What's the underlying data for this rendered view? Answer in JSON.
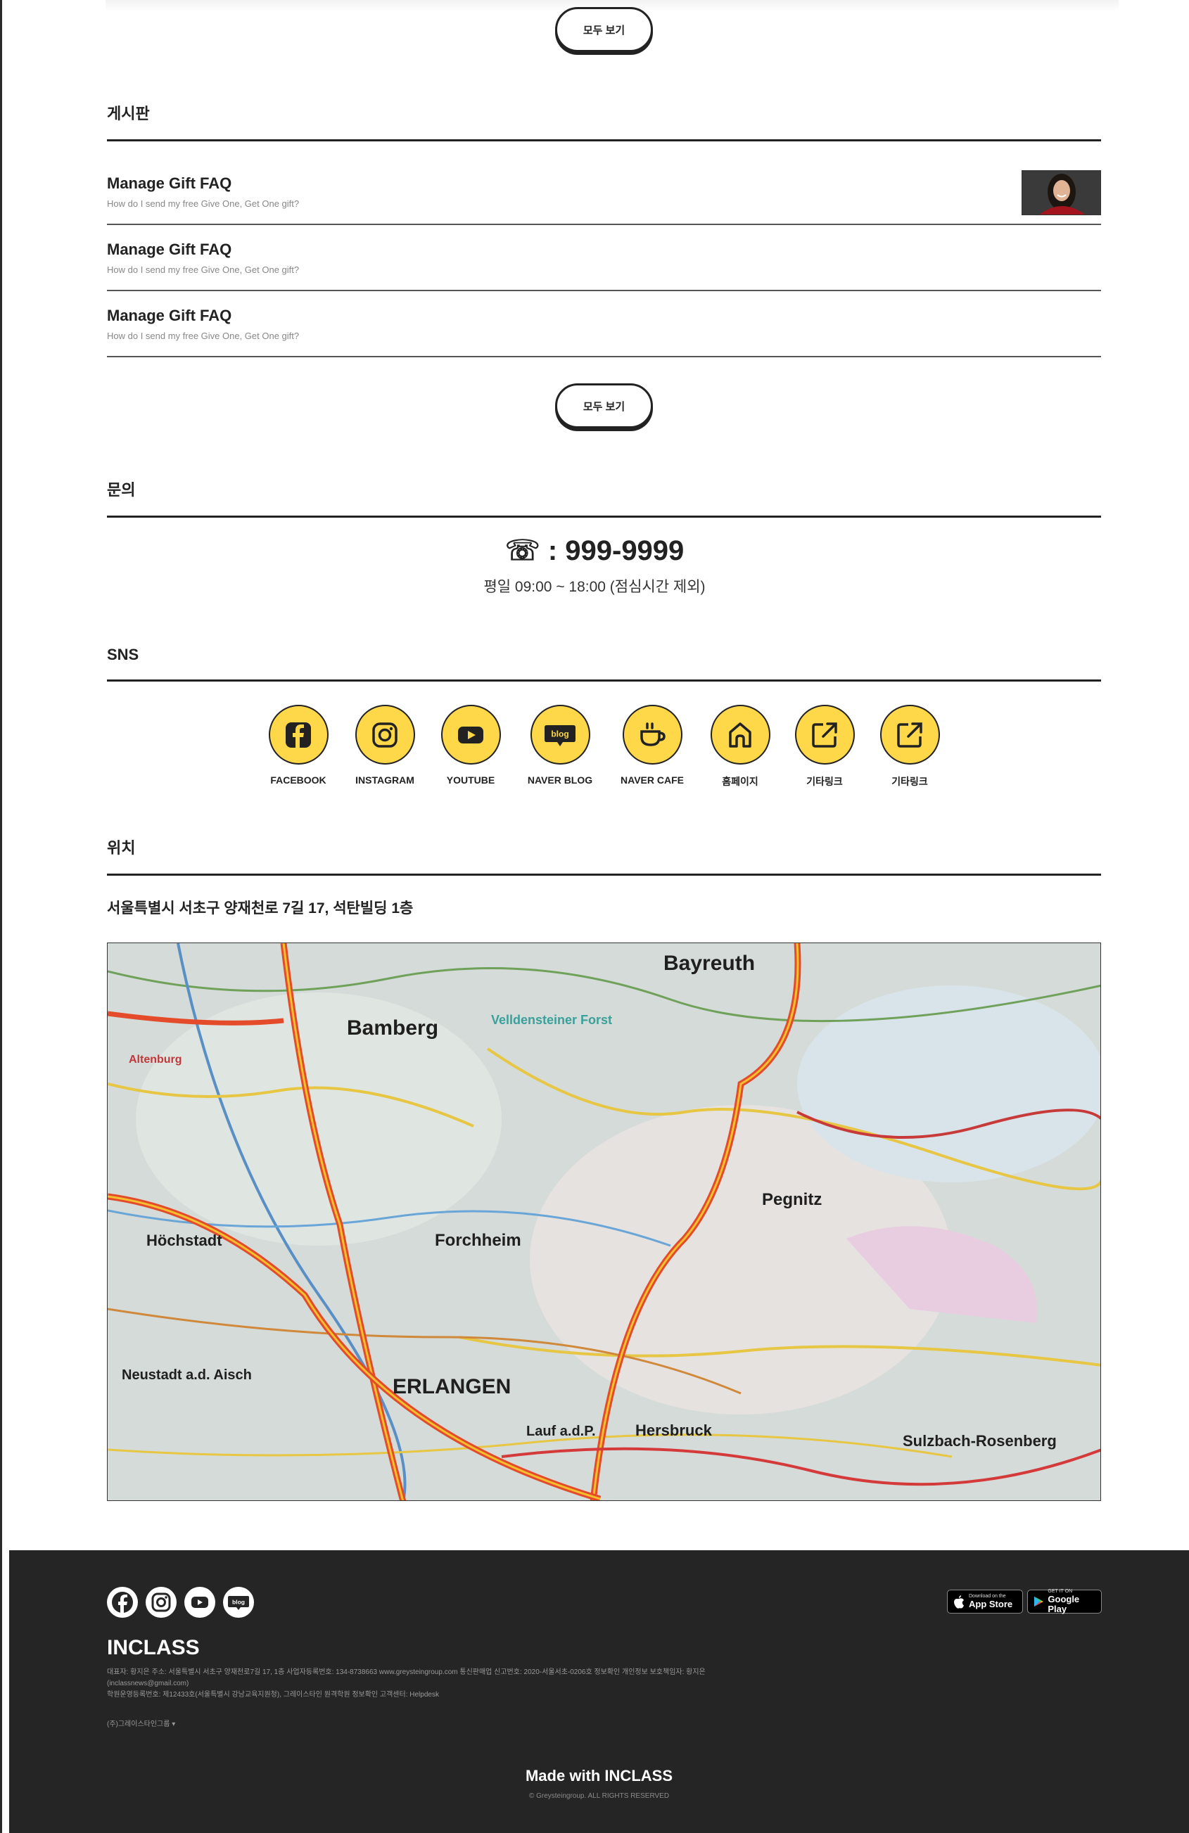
{
  "view_all_label": "모두 보기",
  "board": {
    "heading": "게시판",
    "posts": [
      {
        "title": "Manage Gift FAQ",
        "subtitle": "How do I send my free Give One, Get One gift?"
      },
      {
        "title": "Manage Gift FAQ",
        "subtitle": "How do I send my free Give One, Get One gift?"
      },
      {
        "title": "Manage Gift FAQ",
        "subtitle": "How do I send my free Give One, Get One gift?"
      }
    ]
  },
  "contact": {
    "heading": "문의",
    "phone": "☏ : 999-9999",
    "hours": "평일 09:00 ~ 18:00 (점심시간 제외)"
  },
  "sns": {
    "heading": "SNS",
    "accent_color": "#FFD84A",
    "items": [
      {
        "label": "FACEBOOK",
        "icon": "facebook-icon"
      },
      {
        "label": "INSTAGRAM",
        "icon": "instagram-icon"
      },
      {
        "label": "YOUTUBE",
        "icon": "youtube-icon"
      },
      {
        "label": "NAVER BLOG",
        "icon": "blog-icon"
      },
      {
        "label": "NAVER CAFE",
        "icon": "cafe-icon"
      },
      {
        "label": "홈페이지",
        "icon": "home-icon"
      },
      {
        "label": "기타링크",
        "icon": "external-link-icon"
      },
      {
        "label": "기타링크",
        "icon": "external-link-icon"
      }
    ]
  },
  "location": {
    "heading": "위치",
    "address": "서울특별시 서초구 양재천로 7길 17, 석탄빌딩 1층",
    "map_labels": [
      "Bayreuth",
      "Bamberg",
      "Forchheim",
      "Pegnitz",
      "Höchstadt",
      "ERLANGEN",
      "Hersbruck",
      "Lauf a.d.P.",
      "Neustadt a.d. Aisch",
      "Sulzbach-Rosenberg",
      "Velldensteiner Forst",
      "Altenburg"
    ]
  },
  "footer": {
    "background": "#252525",
    "social_icons": [
      "facebook-icon",
      "instagram-icon",
      "youtube-icon",
      "blog-icon"
    ],
    "blog_text": "blog",
    "app_store": {
      "small": "Download on the",
      "big": "App Store"
    },
    "google_play": {
      "small": "GET IT ON",
      "big": "Google Play"
    },
    "brand": "INCLASS",
    "info_line1": "대표자: 황지은 주소: 서울특별시 서초구 양재천로7길 17, 1층 사업자등록번호: 134-8738663 www.greysteingroup.com 통신판매업 신고번호: 2020-서울서초-0206호 정보확인 개인정보 보호책임자: 황지은",
    "info_line2": "(inclassnews@gmail.com)",
    "info_line3": "학원운영등록번호: 제12433호(서울특별시 강남교육지원청), 그레이스타인 원격학원 정보확인 고객센터: Helpdesk",
    "family_site": "(주)그레이스타인그룹 ▾",
    "made_with": "Made with INCLASS",
    "copyright": "© Greysteingroup. ALL RIGHTS RESERVED"
  }
}
